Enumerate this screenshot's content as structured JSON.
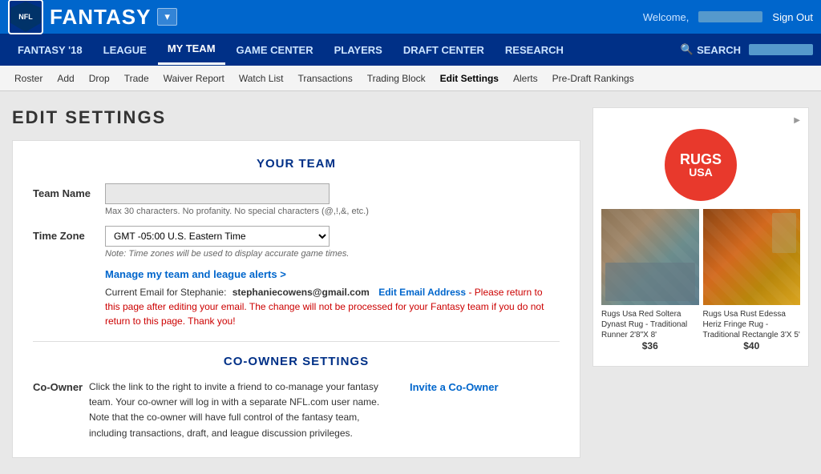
{
  "topBar": {
    "logoText": "NFL",
    "fantasyTitle": "FANTASY",
    "dropdownLabel": "▾",
    "welcome": "Welcome,",
    "signOut": "Sign Out"
  },
  "nav": {
    "items": [
      {
        "label": "FANTASY '18",
        "active": false
      },
      {
        "label": "LEAGUE",
        "active": false
      },
      {
        "label": "MY TEAM",
        "active": true
      },
      {
        "label": "GAME CENTER",
        "active": false
      },
      {
        "label": "PLAYERS",
        "active": false
      },
      {
        "label": "DRAFT CENTER",
        "active": false
      },
      {
        "label": "RESEARCH",
        "active": false
      }
    ],
    "searchLabel": "SEARCH"
  },
  "subNav": {
    "items": [
      {
        "label": "Roster",
        "active": false
      },
      {
        "label": "Add",
        "active": false
      },
      {
        "label": "Drop",
        "active": false
      },
      {
        "label": "Trade",
        "active": false
      },
      {
        "label": "Waiver Report",
        "active": false
      },
      {
        "label": "Watch List",
        "active": false
      },
      {
        "label": "Transactions",
        "active": false
      },
      {
        "label": "Trading Block",
        "active": false
      },
      {
        "label": "Edit Settings",
        "active": true
      },
      {
        "label": "Alerts",
        "active": false
      },
      {
        "label": "Pre-Draft Rankings",
        "active": false
      }
    ]
  },
  "pageTitle": "EDIT SETTINGS",
  "yourTeam": {
    "sectionTitle": "YOUR TEAM",
    "teamNameLabel": "Team Name",
    "teamNamePlaceholder": "",
    "teamNameHint": "Max 30 characters. No profanity. No special characters (@,!,&, etc.)",
    "timeZoneLabel": "Time Zone",
    "timeZoneValue": "GMT -05:00 U.S. Eastern Time",
    "timeZoneHint": "Note: Time zones will be used to display accurate game times.",
    "manageLink": "Manage my team and league alerts >",
    "emailLabel": "Current Email for Stephanie:",
    "emailAddress": "stephaniecowens@gmail.com",
    "editEmailLabel": "Edit Email Address",
    "editEmailNote": "- Please return to this page after editing your email. The change will not be processed for your Fantasy team if you do not return to this page. Thank you!"
  },
  "coOwner": {
    "sectionTitle": "CO-OWNER SETTINGS",
    "label": "Co-Owner",
    "text": "Click the link to the right to invite a friend to co-manage your fantasy team. Your co-owner will log in with a separate NFL.com user name. Note that the co-owner will have full control of the fantasy team, including transactions, draft, and league discussion privileges.",
    "inviteLink": "Invite a Co-Owner"
  },
  "ad": {
    "indicator": "▶",
    "brandName": "RUGS",
    "brandSub": "USA",
    "item1": {
      "caption": "Rugs Usa Red Soltera Dynast Rug - Traditional Runner 2'8\"X 8'",
      "price": "$36"
    },
    "item2": {
      "caption": "Rugs Usa Rust Edessa Heriz Fringe Rug - Traditional Rectangle 3'X 5'",
      "price": "$40"
    }
  }
}
